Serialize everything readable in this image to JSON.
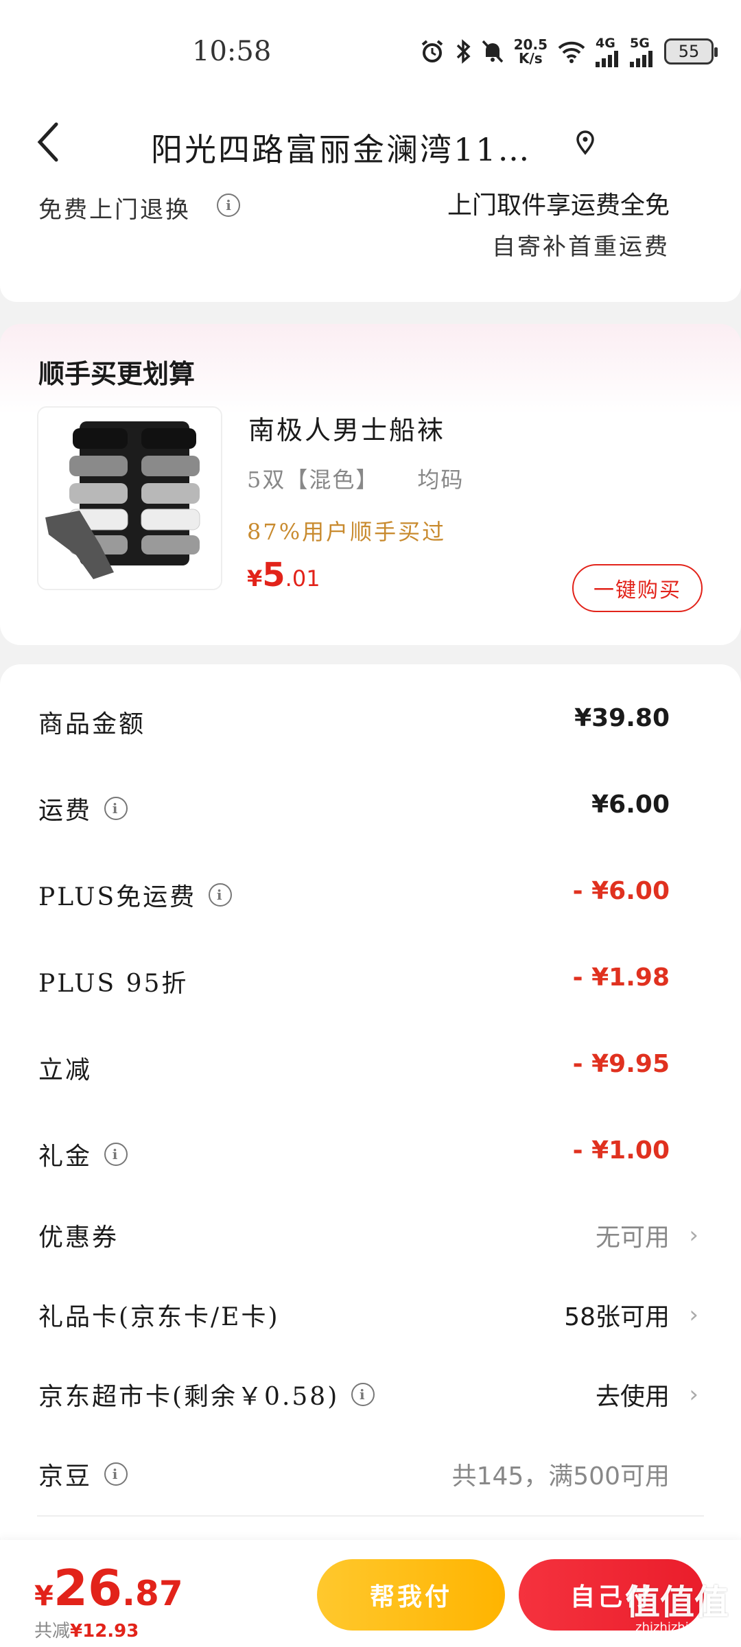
{
  "status_bar": {
    "time": "10:58",
    "net_speed_value": "20.5",
    "net_speed_unit": "K/s",
    "signal1_label": "4G",
    "signal2_label": "5G",
    "battery": "55"
  },
  "header": {
    "address": "阳光四路富丽金澜湾11…"
  },
  "return_service": {
    "label": "免费上门退换",
    "main": "上门取件享运费全免",
    "sub": "自寄补首重运费"
  },
  "recommend": {
    "title": "顺手买更划算",
    "product_name": "南极人男士船袜",
    "spec_qty": "5双【混色】",
    "spec_size": "均码",
    "note": "87%用户顺手买过",
    "price_symbol": "¥",
    "price_int": "5",
    "price_dec": ".01",
    "buy_label": "一键购买"
  },
  "summary": {
    "rows": [
      {
        "label": "商品金额",
        "value": "¥39.80"
      },
      {
        "label": "运费",
        "value": "¥6.00"
      },
      {
        "label": "PLUS免运费",
        "value": "- ¥6.00"
      },
      {
        "label": "PLUS 95折",
        "value": "- ¥1.98"
      },
      {
        "label": "立减",
        "value": "- ¥9.95"
      },
      {
        "label": "礼金",
        "value": "- ¥1.00"
      },
      {
        "label": "优惠券",
        "value": "无可用"
      },
      {
        "label": "礼品卡(京东卡/E卡)",
        "value": "58张可用"
      },
      {
        "label": "京东超市卡(剩余￥0.58)",
        "value": "去使用"
      },
      {
        "label": "京豆",
        "value": "共145，满500可用"
      }
    ]
  },
  "bottom": {
    "total_symbol": "¥",
    "total_int": "26",
    "total_dec": ".87",
    "saved_label": "共减",
    "saved_amount": "¥12.93",
    "help_pay_label": "帮我付",
    "self_pay_label": "自己付"
  },
  "watermark": {
    "big": "值值值",
    "small": "zhizhizhi.com"
  },
  "colors": {
    "accent_red": "#e2231a",
    "discount_red": "#e0311f",
    "gold_note": "#c88a2e",
    "help_btn_yellow": "#ffbe1a"
  }
}
